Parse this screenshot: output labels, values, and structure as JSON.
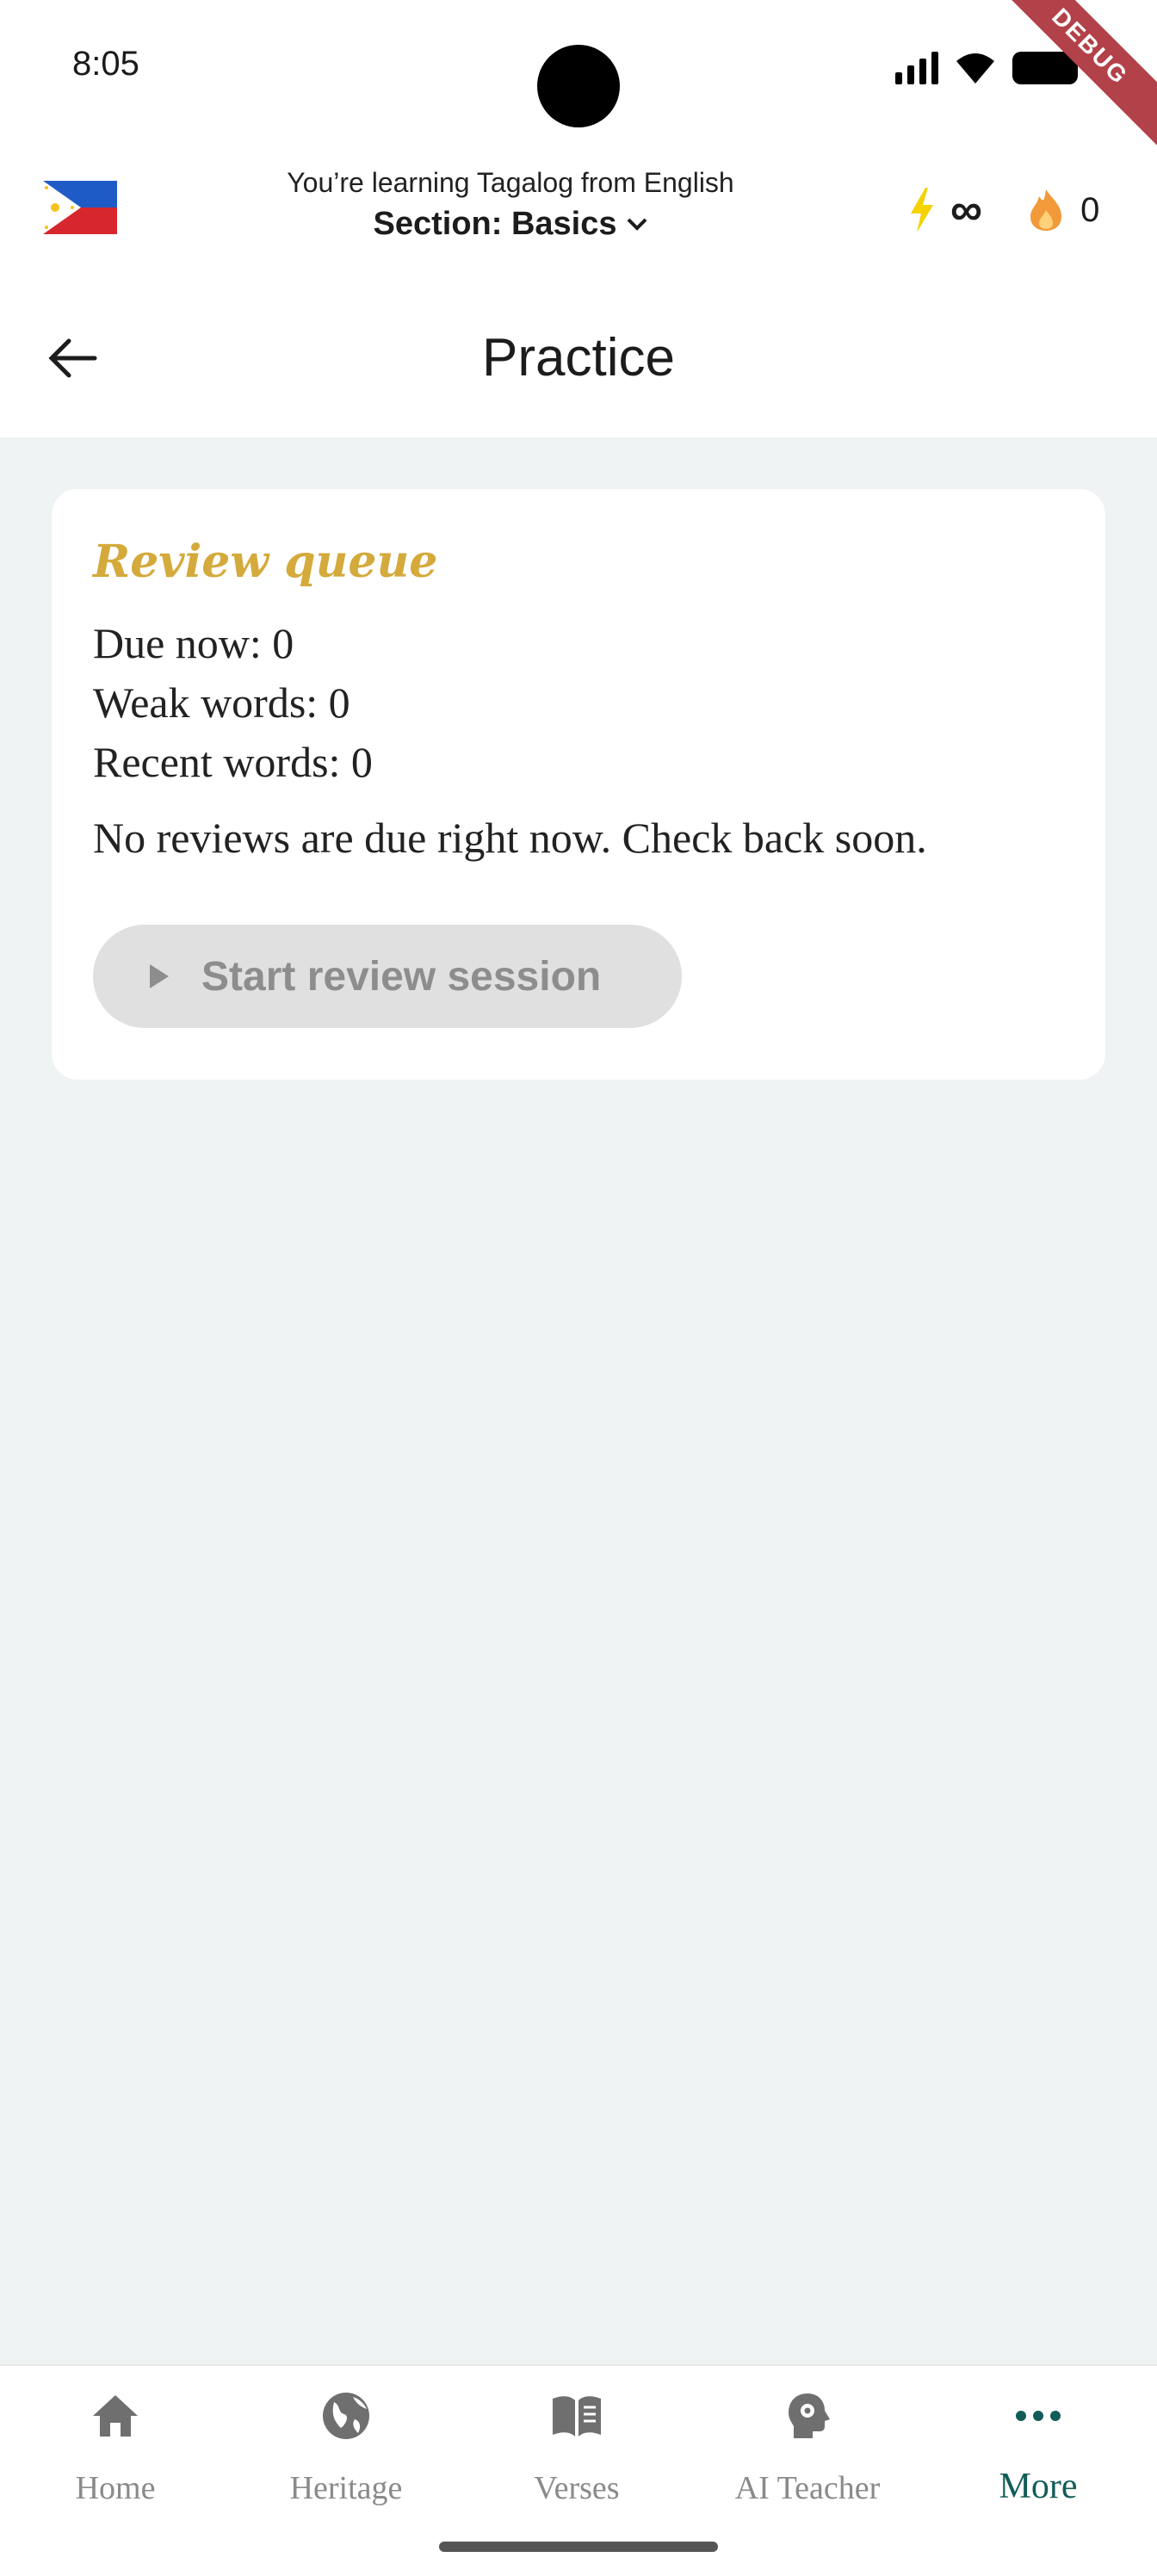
{
  "status_bar": {
    "time": "8:05",
    "icons": [
      "signal-icon",
      "wifi-icon",
      "battery-icon"
    ],
    "debug_banner": "DEBUG"
  },
  "course": {
    "flag": "philippines-flag-icon",
    "subtitle": "You’re learning Tagalog from English",
    "section_label": "Section: Basics",
    "energy_value": "∞",
    "streak_value": "0",
    "energy_color": "#f5d200",
    "streak_color": "#f2993a"
  },
  "app_bar": {
    "title": "Practice"
  },
  "review_card": {
    "title": "Review queue",
    "due_now": "Due now: 0",
    "weak_words": "Weak words: 0",
    "recent_words": "Recent words: 0",
    "message": "No reviews are due right now. Check back soon.",
    "start_button": "Start review session",
    "title_color": "#d4aa3c"
  },
  "bottom_nav": {
    "items": [
      {
        "label": "Home",
        "icon": "home-icon"
      },
      {
        "label": "Heritage",
        "icon": "globe-icon"
      },
      {
        "label": "Verses",
        "icon": "book-icon"
      },
      {
        "label": "AI Teacher",
        "icon": "ai-head-icon"
      },
      {
        "label": "More",
        "icon": "more-icon"
      }
    ],
    "active": "More",
    "active_color": "#125c58"
  }
}
